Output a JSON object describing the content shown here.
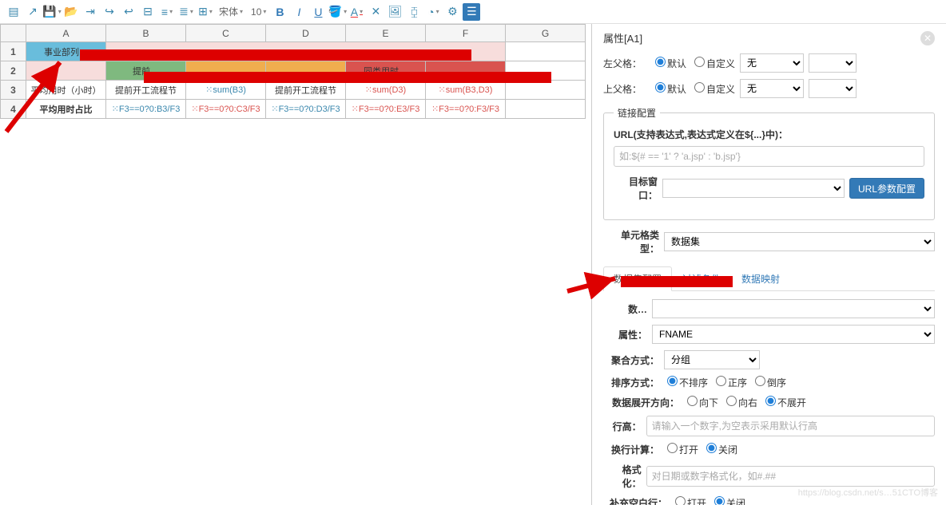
{
  "toolbar": {
    "font": "宋体",
    "size": "10",
    "bold": "B",
    "italic": "I",
    "underline": "U"
  },
  "sheet": {
    "cols": [
      "",
      "A",
      "B",
      "C",
      "D",
      "E",
      "F",
      "G"
    ],
    "rows": [
      {
        "n": "1",
        "cells": [
          {
            "txt": "事业部列…",
            "cls": "a1"
          },
          {
            "txt": "",
            "cls": "r1merge",
            "span": 5
          },
          {
            "txt": "",
            "cls": ""
          }
        ]
      },
      {
        "n": "2",
        "cells": [
          {
            "txt": "",
            "cls": "r1merge"
          },
          {
            "txt": "提前…",
            "cls": "b2"
          },
          {
            "txt": "",
            "cls": "c2"
          },
          {
            "txt": "",
            "cls": "c2"
          },
          {
            "txt": "同类用时…",
            "cls": "f2"
          },
          {
            "txt": "",
            "cls": "f2"
          },
          {
            "txt": "",
            "cls": ""
          }
        ]
      },
      {
        "n": "3",
        "cells": [
          {
            "txt": "平均用时（小时）",
            "cls": ""
          },
          {
            "txt": "提前开工流程节",
            "cls": ""
          },
          {
            "txt": "⁙sum(B3)",
            "cls": "formula"
          },
          {
            "txt": "提前开工流程节",
            "cls": ""
          },
          {
            "txt": "⁙sum(D3)",
            "cls": "fred"
          },
          {
            "txt": "⁙sum(B3,D3)",
            "cls": "fred"
          },
          {
            "txt": "",
            "cls": ""
          }
        ]
      },
      {
        "n": "4",
        "cells": [
          {
            "txt": "平均用时占比",
            "cls": "",
            "b": true
          },
          {
            "txt": "⁙F3==0?0:B3/F3",
            "cls": "formula"
          },
          {
            "txt": "⁙F3==0?0:C3/F3",
            "cls": "fred"
          },
          {
            "txt": "⁙F3==0?0:D3/F3",
            "cls": "formula"
          },
          {
            "txt": "⁙F3==0?0:E3/F3",
            "cls": "fred"
          },
          {
            "txt": "⁙F3==0?0:F3/F3",
            "cls": "fred"
          },
          {
            "txt": "",
            "cls": ""
          }
        ]
      }
    ]
  },
  "props": {
    "title": "属性[A1]",
    "leftParent": "左父格：",
    "topParent": "上父格：",
    "defaultOpt": "默认",
    "customOpt": "自定义",
    "noneOpt": "无",
    "linkGroup": "链接配置",
    "urlLabel": "URL(支持表达式,表达式定义在${...}中)：",
    "urlPlaceholder": "如:${# == '1' ? 'a.jsp' : 'b.jsp'}",
    "targetWin": "目标窗口：",
    "urlBtn": "URL参数配置",
    "cellType": "单元格类型：",
    "cellTypeVal": "数据集",
    "tabs": {
      "a": "数据集配置",
      "b": "过滤条件",
      "c": "数据映射"
    },
    "datasetLbl": "数…",
    "attrLbl": "属性：",
    "attrVal": "FNAME",
    "aggLbl": "聚合方式：",
    "aggVal": "分组",
    "sortLbl": "排序方式：",
    "sortOpts": {
      "none": "不排序",
      "asc": "正序",
      "desc": "倒序"
    },
    "expandLbl": "数据展开方向：",
    "expandOpts": {
      "down": "向下",
      "right": "向右",
      "none": "不展开"
    },
    "rowHeightLbl": "行高：",
    "rowHeightPh": "请输入一个数字,为空表示采用默认行高",
    "wrapLbl": "换行计算：",
    "wrapOpts": {
      "on": "打开",
      "off": "关闭"
    },
    "fmtLbl": "格式化：",
    "fmtPh": "对日期或数字格式化，如#.##",
    "fillLbl": "补充空白行：",
    "fillOpts": {
      "on": "打开",
      "off": "关闭"
    }
  },
  "watermark": "https://blog.csdn.net/s…51CTO博客"
}
